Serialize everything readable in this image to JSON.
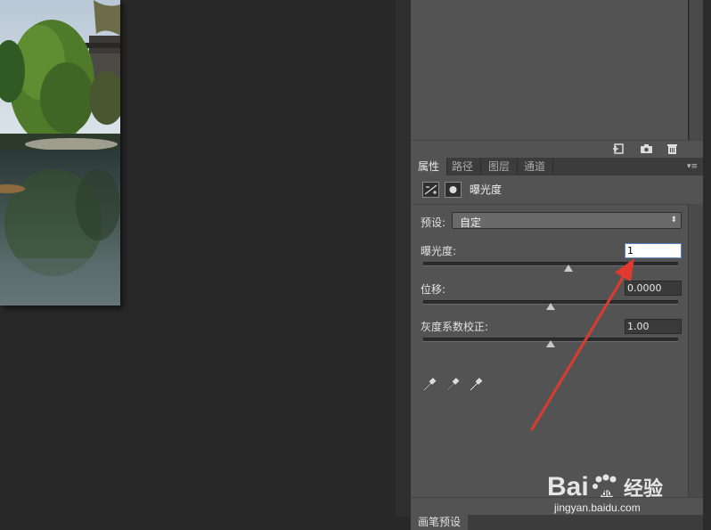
{
  "properties_panel": {
    "tabs": [
      {
        "label": "属性",
        "active": true
      },
      {
        "label": "路径",
        "active": false
      },
      {
        "label": "图层",
        "active": false
      },
      {
        "label": "通道",
        "active": false
      }
    ],
    "title": "曝光度",
    "preset": {
      "label": "预设:",
      "value": "自定"
    },
    "exposure": {
      "label": "曝光度:",
      "value": "1",
      "slider_position": 0.57
    },
    "offset": {
      "label": "位移:",
      "value": "0.0000",
      "slider_position": 0.5
    },
    "gamma": {
      "label": "灰度系数校正:",
      "value": "1.00",
      "slider_position": 0.5
    }
  },
  "brush_preset_tab": {
    "label": "画笔预设"
  },
  "watermark": {
    "brand": "Bai",
    "brand_suffix": "经验",
    "url": "jingyan.baidu.com"
  },
  "colors": {
    "panel": "#535353",
    "annotation_arrow": "#e03a30",
    "input_focus_border": "#5a86c5"
  }
}
